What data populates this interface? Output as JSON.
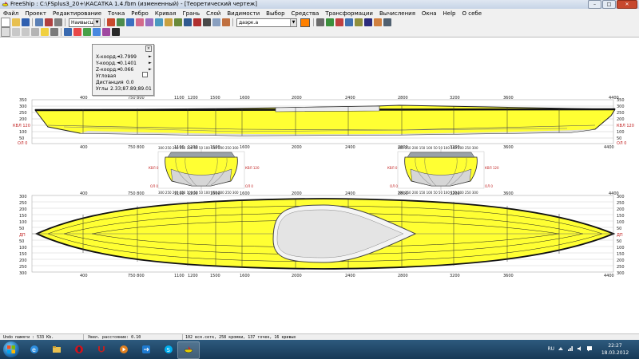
{
  "window": {
    "title": "FreeShip : C:\\FSplus3_20+\\КАСАТКА 1.4.fbm (измененный) - [Теоретический чертеж]",
    "min_label": "–",
    "max_label": "□",
    "close_label": "✕",
    "app_icon": "freeship-app-icon"
  },
  "menu": [
    "Файл",
    "Проект",
    "Редактирование",
    "Точка",
    "Ребро",
    "Кривая",
    "Грань",
    "Слой",
    "Видимости",
    "Выбор",
    "Средства",
    "Трансформации",
    "Вычисления",
    "Окна",
    "Help",
    "О себе"
  ],
  "toolbar": {
    "layer_select": "Наивысш",
    "layer_select2": "даэрк.а",
    "accent_color": "#ff8000"
  },
  "coord_panel": {
    "close_label": "×",
    "x_label": "X-коорд.",
    "x_value": "3.7999",
    "y_label": "Y-коорд.",
    "y_value": "0.1401",
    "z_label": "Z-коорд.",
    "z_value": "0.066",
    "angle_label": "Угловая",
    "distance_label": "Дистанция",
    "distance_value": "0.0",
    "angles_label": "Углы",
    "angles_value": "2.33;87.89;89.01"
  },
  "drawing": {
    "hull_fill": "#ffff33",
    "profile_view": {
      "x_ticks": [
        "400",
        "750 800",
        "1100",
        "1200",
        "1500",
        "1600",
        "2000",
        "2400",
        "2800",
        "3200",
        "3600",
        "4400"
      ],
      "y_ticks": [
        "350",
        "300",
        "250",
        "200",
        "150",
        "100",
        "50"
      ],
      "wl_left": "КВЛ 120",
      "wl_right": "КВЛ 120",
      "base_left": "ОЛ 0",
      "base_right": "ОЛ 0",
      "corner_right": "4400"
    },
    "body_plan_left": {
      "scale": "300 250 200 150 100 50 50 100 150 200 250 300",
      "wl_left": "КВЛ 0",
      "wl_right": "КВЛ 120",
      "base_left": "ОЛ 0",
      "base_right": "ОЛ 0"
    },
    "body_plan_right": {
      "scale": "300 250 200 150 100 50 50 100 150 200 250 300",
      "wl_left": "КВЛ 0",
      "wl_right": "КВЛ 120",
      "base_left": "ОЛ 0",
      "base_right": "ОЛ 0"
    },
    "plan_view": {
      "x_ticks": [
        "400",
        "750 800",
        "1100",
        "1200",
        "1500",
        "1600",
        "2000",
        "2400",
        "2800",
        "3200",
        "3600",
        "4400"
      ],
      "y_ticks": [
        "300",
        "250",
        "200",
        "150",
        "100",
        "50",
        "0",
        "50",
        "100",
        "150",
        "200",
        "250",
        "300"
      ],
      "dp_left": "ДП",
      "dp_right": "ДП"
    }
  },
  "status": {
    "undo": "Undo памяти : 533 Kb.",
    "distance": "Увел. расстояние: 0.10",
    "stats": "102 вся.сетк, 258 кромки, 137 точек, 16 кривых"
  },
  "taskbar": {
    "lang": "RU",
    "time": "22:27",
    "date": "18.03.2012"
  }
}
